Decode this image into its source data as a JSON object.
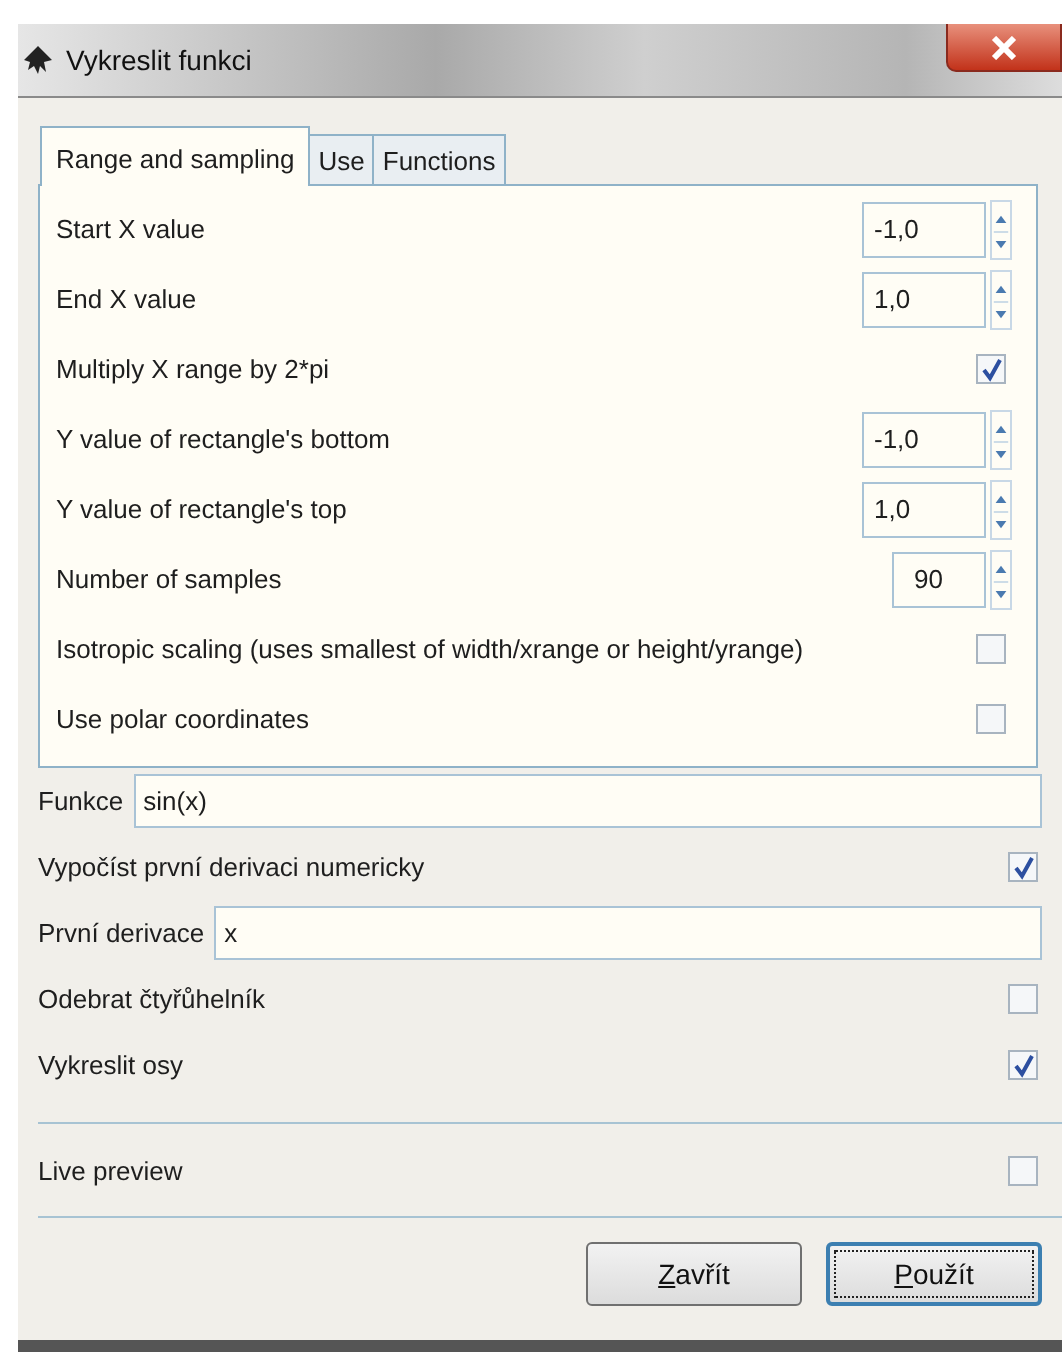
{
  "window": {
    "title": "Vykreslit funkci"
  },
  "tabs": [
    {
      "label": "Range and sampling",
      "selected": true
    },
    {
      "label": "Use",
      "selected": false
    },
    {
      "label": "Functions",
      "selected": false
    }
  ],
  "range_settings": [
    {
      "kind": "spin",
      "label": "Start X value",
      "value": "-1,0"
    },
    {
      "kind": "spin",
      "label": "End X value",
      "value": "1,0"
    },
    {
      "kind": "check",
      "label": "Multiply X range by 2*pi",
      "checked": true
    },
    {
      "kind": "spin",
      "label": "Y value of rectangle's bottom",
      "value": "-1,0"
    },
    {
      "kind": "spin",
      "label": "Y value of rectangle's top",
      "value": "1,0"
    },
    {
      "kind": "spin_small",
      "label": "Number of samples",
      "value": "90"
    },
    {
      "kind": "check",
      "label": "Isotropic scaling (uses smallest of width/xrange or height/yrange)",
      "checked": false
    },
    {
      "kind": "check",
      "label": "Use polar coordinates",
      "checked": false
    }
  ],
  "function_settings": [
    {
      "kind": "entry",
      "label": "Funkce",
      "value": "sin(x)"
    },
    {
      "kind": "check",
      "label": "Vypočíst první derivaci numericky",
      "checked": true
    },
    {
      "kind": "entry",
      "label": "První derivace",
      "value": "x"
    },
    {
      "kind": "check",
      "label": "Odebrat čtyřůhelník",
      "checked": false
    },
    {
      "kind": "check",
      "label": "Vykreslit osy",
      "checked": true
    }
  ],
  "live_preview": {
    "label": "Live preview",
    "checked": false
  },
  "buttons": [
    {
      "label": "Zavřít",
      "mnemonic": true,
      "focused": false
    },
    {
      "label": "Použít",
      "mnemonic": true,
      "focused": true
    }
  ]
}
